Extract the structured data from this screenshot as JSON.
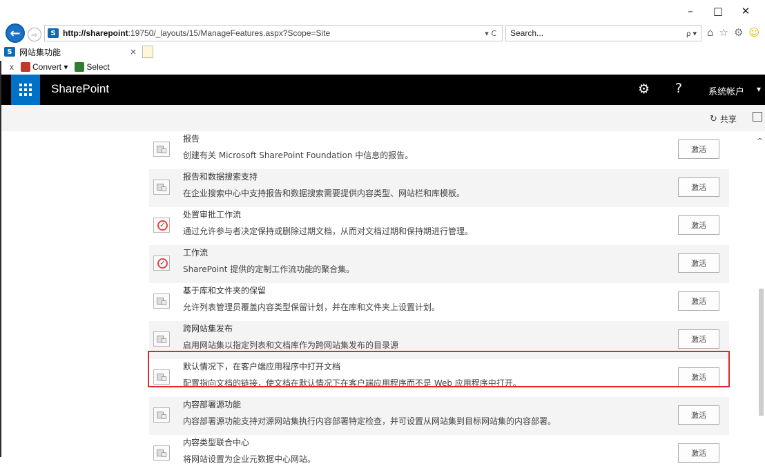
{
  "window": {
    "minimize": "–",
    "maximize": "□",
    "close": "✕"
  },
  "browser": {
    "url_host": "http://sharepoint",
    "url_rest": ":19750/_layouts/15/ManageFeatures.aspx?Scope=Site",
    "refresh": "▾ C",
    "search_value": "Search...",
    "search_icon": "ρ ▾",
    "toolbar_icons": [
      "home-icon",
      "star-icon",
      "gear-icon",
      "smiley-icon"
    ],
    "tab_title": "网站集功能",
    "tab_close": "×",
    "cmd_close": "x",
    "cmd_convert": "Convert",
    "cmd_select": "Select"
  },
  "suitebar": {
    "brand": "SharePoint",
    "user": "系统帐户",
    "help": "?"
  },
  "ribbon": {
    "share": "共享"
  },
  "features": [
    {
      "title": "报告",
      "desc": "创建有关 Microsoft SharePoint Foundation 中信息的报告。",
      "action": "激活",
      "icon": "feature"
    },
    {
      "title": "报告和数据搜索支持",
      "desc": "在企业搜索中心中支持报告和数据搜索需要提供内容类型、网站栏和库模板。",
      "action": "激活",
      "icon": "feature"
    },
    {
      "title": "处置审批工作流",
      "desc": "通过允许参与者决定保持或删除过期文档，从而对文档过期和保持期进行管理。",
      "action": "激活",
      "icon": "workflow"
    },
    {
      "title": "工作流",
      "desc": "SharePoint 提供的定制工作流功能的聚合集。",
      "action": "激活",
      "icon": "workflow"
    },
    {
      "title": "基于库和文件夹的保留",
      "desc": "允许列表管理员覆盖内容类型保留计划，并在库和文件夹上设置计划。",
      "action": "激活",
      "icon": "feature"
    },
    {
      "title": "跨网站集发布",
      "desc": "启用网站集以指定列表和文档库作为跨网站集发布的目录源",
      "action": "激活",
      "icon": "feature"
    },
    {
      "title": "默认情况下，在客户端应用程序中打开文档",
      "desc": "配置指向文档的链接，使文档在默认情况下在客户端应用程序而不是 Web 应用程序中打开。",
      "action": "激活",
      "icon": "feature"
    },
    {
      "title": "内容部署源功能",
      "desc": "内容部署源功能支持对源网站集执行内容部署特定检查，并可设置从网站集到目标网站集的内容部署。",
      "action": "激活",
      "icon": "feature"
    },
    {
      "title": "内容类型联合中心",
      "desc": "将网站设置为企业元数据中心网站。",
      "action": "激活",
      "icon": "feature"
    }
  ]
}
